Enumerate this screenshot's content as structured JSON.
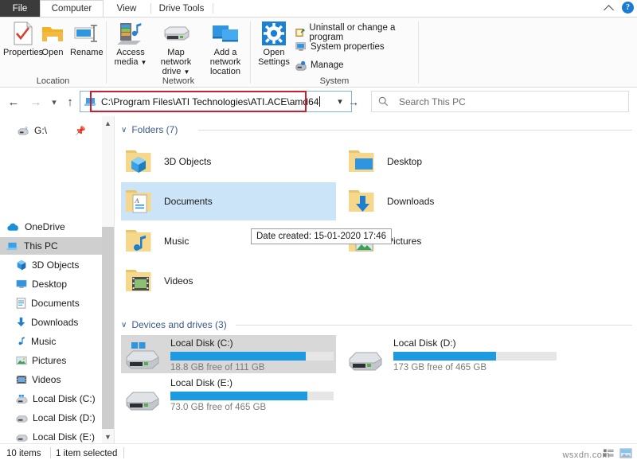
{
  "tabs": {
    "file": "File",
    "items": [
      {
        "label": "Computer",
        "active": true
      },
      {
        "label": "View",
        "active": false
      },
      {
        "label": "Drive Tools",
        "active": false
      }
    ],
    "collapse_icon": "chevron-up-icon",
    "help_icon": "help-icon",
    "help_glyph": "?"
  },
  "ribbon": {
    "groups": [
      {
        "label": "Location",
        "buttons": [
          {
            "label": "Properties",
            "icon": "properties-icon"
          },
          {
            "label": "Open",
            "icon": "open-folder-icon"
          },
          {
            "label": "Rename",
            "icon": "rename-icon"
          }
        ]
      },
      {
        "label": "Network",
        "buttons": [
          {
            "label": "Access media",
            "icon": "access-media-icon",
            "dropdown": true
          },
          {
            "label": "Map network drive",
            "icon": "map-network-drive-icon",
            "dropdown": true
          },
          {
            "label": "Add a network location",
            "icon": "add-network-location-icon",
            "dropdown": false
          }
        ]
      },
      {
        "label": "System",
        "buttons": [
          {
            "label": "Open Settings",
            "icon": "settings-gear-icon"
          }
        ],
        "small_buttons": [
          {
            "label": "Uninstall or change a program",
            "icon": "uninstall-program-icon"
          },
          {
            "label": "System properties",
            "icon": "system-properties-icon"
          },
          {
            "label": "Manage",
            "icon": "manage-icon"
          }
        ]
      }
    ]
  },
  "navigation": {
    "back_icon": "back-arrow-icon",
    "forward_icon": "forward-arrow-icon",
    "recent_icon": "chevron-down-icon",
    "up_icon": "up-arrow-icon",
    "go_icon": "go-arrow-icon"
  },
  "address_bar": {
    "icon": "this-pc-icon",
    "value": "C:\\Program Files\\ATI Technologies\\ATI.ACE\\amd64",
    "dropdown_icon": "chevron-down-icon",
    "highlight_color": "#cc1f2e",
    "focus_border_color": "#7fb2e0"
  },
  "search": {
    "icon": "search-icon",
    "placeholder": "Search This PC"
  },
  "sidebar": {
    "scroll_up_icon": "scroll-up-icon",
    "scroll_down_icon": "scroll-down-icon",
    "items": [
      {
        "label": "G:\\",
        "icon": "network-drive-icon",
        "indent": 1,
        "pinned": true,
        "selected": false
      },
      {
        "label": "OneDrive",
        "icon": "onedrive-icon",
        "indent": 0,
        "selected": false
      },
      {
        "label": "This PC",
        "icon": "this-pc-icon",
        "indent": 0,
        "selected": true
      },
      {
        "label": "3D Objects",
        "icon": "3d-objects-icon",
        "indent": 1,
        "selected": false
      },
      {
        "label": "Desktop",
        "icon": "desktop-icon",
        "indent": 1,
        "selected": false
      },
      {
        "label": "Documents",
        "icon": "documents-icon",
        "indent": 1,
        "selected": false
      },
      {
        "label": "Downloads",
        "icon": "downloads-icon",
        "indent": 1,
        "selected": false
      },
      {
        "label": "Music",
        "icon": "music-icon",
        "indent": 1,
        "selected": false
      },
      {
        "label": "Pictures",
        "icon": "pictures-icon",
        "indent": 1,
        "selected": false
      },
      {
        "label": "Videos",
        "icon": "videos-icon",
        "indent": 1,
        "selected": false
      },
      {
        "label": "Local Disk (C:)",
        "icon": "windows-drive-icon",
        "indent": 1,
        "selected": false
      },
      {
        "label": "Local Disk (D:)",
        "icon": "drive-icon",
        "indent": 1,
        "selected": false
      },
      {
        "label": "Local Disk (E:)",
        "icon": "drive-icon",
        "indent": 1,
        "selected": false
      }
    ]
  },
  "content": {
    "folders_group": {
      "label": "Folders (7)",
      "chevron": "∨",
      "items": [
        {
          "name": "3D Objects",
          "icon": "folder-3d-objects-icon",
          "selected": false
        },
        {
          "name": "Desktop",
          "icon": "folder-desktop-icon",
          "selected": false
        },
        {
          "name": "Documents",
          "icon": "folder-documents-icon",
          "selected": true
        },
        {
          "name": "Downloads",
          "icon": "folder-downloads-icon",
          "selected": false
        },
        {
          "name": "Music",
          "icon": "folder-music-icon",
          "selected": false
        },
        {
          "name": "Pictures",
          "icon": "folder-pictures-icon",
          "selected": false
        },
        {
          "name": "Videos",
          "icon": "folder-videos-icon",
          "selected": false
        }
      ]
    },
    "drives_group": {
      "label": "Devices and drives (3)",
      "chevron": "∨",
      "items": [
        {
          "name": "Local Disk (C:)",
          "icon": "windows-drive-icon",
          "free_text": "18.8 GB free of 111 GB",
          "used_percent": 83,
          "selected": true,
          "bar_color": "#1e9be0"
        },
        {
          "name": "Local Disk (D:)",
          "icon": "drive-icon",
          "free_text": "173 GB free of 465 GB",
          "used_percent": 63,
          "selected": false,
          "bar_color": "#1e9be0"
        },
        {
          "name": "Local Disk (E:)",
          "icon": "drive-icon",
          "free_text": "73.0 GB free of 465 GB",
          "used_percent": 84,
          "selected": false,
          "bar_color": "#1e9be0"
        }
      ]
    }
  },
  "tooltip": {
    "text": "Date created: 15-01-2020 17:46"
  },
  "status_bar": {
    "item_count": "10 items",
    "selection": "1 item selected",
    "details_view_icon": "details-view-icon",
    "large-icons_view_icon": "large-icons-view-icon"
  },
  "watermark": {
    "text": "wsxdn.com"
  }
}
